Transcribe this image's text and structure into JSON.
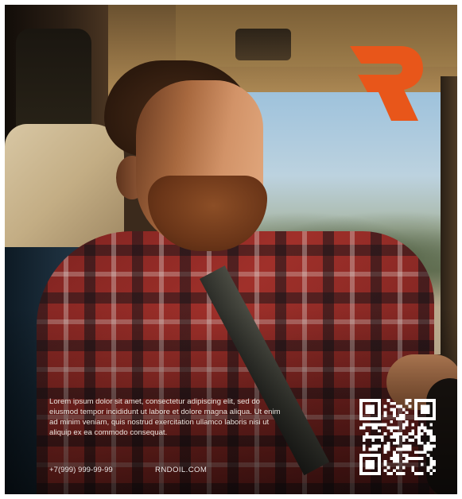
{
  "ad": {
    "body_text": "Lorem ipsum dolor sit amet, consectetur adipiscing elit, sed do eiusmod tempor incididunt ut labore et dolore magna aliqua. Ut enim ad minim veniam, quis nostrud exercitation ullamco laboris nisi ut aliquip ex ea commodo consequat.",
    "phone": "+7(999) 999-99-99",
    "website": "RNDOIL.COM"
  },
  "brand": {
    "logo_icon": "r-letter-logo-icon",
    "accent_color": "#e8561a"
  },
  "qr": {
    "icon": "qr-code-icon",
    "color": "#ffffff"
  }
}
